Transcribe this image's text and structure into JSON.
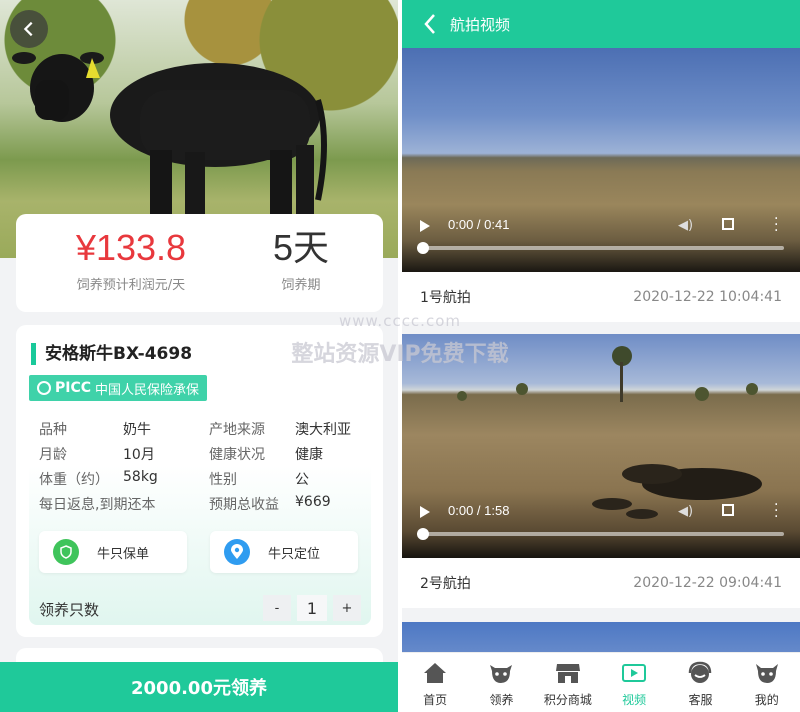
{
  "detail": {
    "stats": {
      "profit_value": "¥133.8",
      "profit_label": "饲养预计利润元/天",
      "period_value": "5天",
      "period_label": "饲养期"
    },
    "cow": {
      "title": "安格斯牛BX-4698",
      "insurance_logo": "PICC",
      "insurance_text": "中国人民保险承保",
      "rows": [
        {
          "l1": "品种",
          "v1": "奶牛",
          "l2": "产地来源",
          "v2": "澳大利亚"
        },
        {
          "l1": "月龄",
          "v1": "10月",
          "l2": "健康状况",
          "v2": "健康"
        },
        {
          "l1": "体重（约）",
          "v1": "58kg",
          "l2": "性别",
          "v2": "公"
        },
        {
          "l1": "每日返息,到期还本",
          "v1": "",
          "l2": "预期总收益",
          "v2": "¥669"
        }
      ],
      "policy_label": "牛只保单",
      "location_label": "牛只定位",
      "quantity_label": "领养只数",
      "minus": "-",
      "quantity": "1",
      "plus": "+"
    },
    "adopt_button": "2000.00元领养"
  },
  "videos_page": {
    "title": "航拍视频",
    "videos": [
      {
        "time": "0:00 / 0:41",
        "name": "1号航拍",
        "date": "2020-12-22 10:04:41"
      },
      {
        "time": "0:00 / 1:58",
        "name": "2号航拍",
        "date": "2020-12-22 09:04:41"
      }
    ],
    "tabs": [
      {
        "label": "首页",
        "icon": "home-icon"
      },
      {
        "label": "领养",
        "icon": "cow-icon"
      },
      {
        "label": "积分商城",
        "icon": "store-icon"
      },
      {
        "label": "视频",
        "icon": "video-icon"
      },
      {
        "label": "客服",
        "icon": "headset-icon"
      },
      {
        "label": "我的",
        "icon": "profile-icon"
      }
    ]
  },
  "watermark": {
    "line1": "www.cccc.com",
    "line2": "整站资源VIP免费下载"
  },
  "colors": {
    "accent": "#1fc99a",
    "price": "#e8383d"
  }
}
